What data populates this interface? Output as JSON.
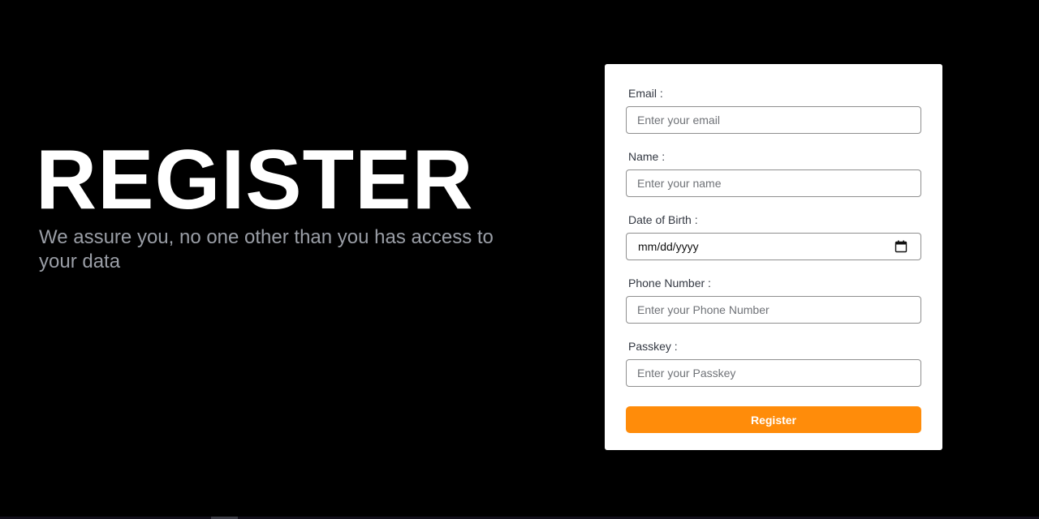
{
  "hero": {
    "title": "REGISTER",
    "subtitle": "We assure you, no one other than you has access to your data"
  },
  "form": {
    "email": {
      "label": "Email :",
      "placeholder": "Enter your email",
      "value": ""
    },
    "name": {
      "label": "Name :",
      "placeholder": "Enter your name",
      "value": ""
    },
    "dob": {
      "label": "Date of Birth :",
      "display": "mm/dd/yyyy",
      "icon": "calendar-icon"
    },
    "phone": {
      "label": "Phone Number :",
      "placeholder": "Enter your Phone Number",
      "value": ""
    },
    "passkey": {
      "label": "Passkey :",
      "placeholder": "Enter your Passkey",
      "value": ""
    },
    "submit_label": "Register"
  },
  "colors": {
    "background": "#000000",
    "card": "#ffffff",
    "accent": "#ff8c0a",
    "subtitle": "#9a9ea6"
  }
}
